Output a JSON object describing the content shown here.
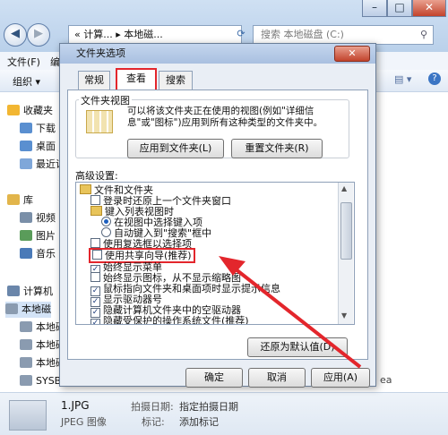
{
  "explorer": {
    "address": "« 计算... ▸ 本地磁...",
    "search_placeholder": "搜索 本地磁盘 (C:)",
    "menu": [
      "文件(F)",
      "编辑"
    ],
    "organize": "组织 ▾",
    "nav": [
      {
        "label": "收藏夹",
        "icon": "star-icon",
        "color": "#f2b632"
      },
      {
        "label": "下载",
        "icon": "folder-icon",
        "color": "#5a8fd0"
      },
      {
        "label": "桌面",
        "icon": "folder-icon",
        "color": "#5a8fd0"
      },
      {
        "label": "最近访",
        "icon": "folder-icon",
        "color": "#7fa7d9"
      },
      {
        "label": "库",
        "icon": "library-icon",
        "color": "#e2b54b"
      },
      {
        "label": "视频",
        "icon": "video-icon",
        "color": "#7a8fa8"
      },
      {
        "label": "图片",
        "icon": "picture-icon",
        "color": "#5a9c5a"
      },
      {
        "label": "音乐",
        "icon": "music-icon",
        "color": "#4a7ab8"
      },
      {
        "label": "计算机",
        "icon": "computer-icon",
        "color": "#6a86aa"
      },
      {
        "label": "本地磁",
        "icon": "drive-icon",
        "color": "#8a9bb0"
      },
      {
        "label": "本地磁",
        "icon": "drive-icon",
        "color": "#8a9bb0"
      },
      {
        "label": "本地磁",
        "icon": "drive-icon",
        "color": "#8a9bb0"
      },
      {
        "label": "本地磁",
        "icon": "drive-icon",
        "color": "#8a9bb0"
      },
      {
        "label": "SYSBA",
        "icon": "drive-icon",
        "color": "#8a9bb0"
      }
    ],
    "right_fragment": "ea",
    "status": {
      "file": "1.JPG",
      "type": "JPEG 图像",
      "k1": "拍摄日期:",
      "v1": "指定拍摄日期",
      "k2": "标记:",
      "v2": "添加标记"
    }
  },
  "dialog": {
    "title": "文件夹选项",
    "close": "✕",
    "tabs": [
      "常规",
      "查看",
      "搜索"
    ],
    "folder_views": {
      "title": "文件夹视图",
      "description": "可以将该文件夹正在使用的视图(例如\"详细信息\"或\"图标\")应用到所有这种类型的文件夹中。",
      "apply_button": "应用到文件夹(L)",
      "reset_button": "重置文件夹(R)"
    },
    "advanced_label": "高级设置:",
    "tree": [
      {
        "kind": "folder",
        "label": "文件和文件夹",
        "indent": 0
      },
      {
        "kind": "checkbox",
        "checked": false,
        "label": "登录时还原上一个文件夹窗口",
        "indent": 1
      },
      {
        "kind": "folder",
        "label": "键入列表视图时",
        "indent": 1
      },
      {
        "kind": "radio",
        "checked": true,
        "label": "在视图中选择键入项",
        "indent": 2
      },
      {
        "kind": "radio",
        "checked": false,
        "label": "自动键入到\"搜索\"框中",
        "indent": 2
      },
      {
        "kind": "checkbox",
        "checked": false,
        "label": "使用复选框以选择项",
        "indent": 1
      },
      {
        "kind": "checkbox",
        "checked": false,
        "label": "使用共享向导(推荐)",
        "indent": 1
      },
      {
        "kind": "checkbox",
        "checked": true,
        "label": "始终显示菜单",
        "indent": 1
      },
      {
        "kind": "checkbox",
        "checked": false,
        "label": "始终显示图标，从不显示缩略图",
        "indent": 1
      },
      {
        "kind": "checkbox",
        "checked": true,
        "label": "鼠标指向文件夹和桌面项时显示提示信息",
        "indent": 1
      },
      {
        "kind": "checkbox",
        "checked": true,
        "label": "显示驱动器号",
        "indent": 1
      },
      {
        "kind": "checkbox",
        "checked": true,
        "label": "隐藏计算机文件夹中的空驱动器",
        "indent": 1
      },
      {
        "kind": "checkbox",
        "checked": true,
        "label": "隐藏受保护的操作系统文件(推荐)",
        "indent": 1
      }
    ],
    "restore_button": "还原为默认值(D)",
    "ok_button": "确定",
    "cancel_button": "取消",
    "apply_button": "应用(A)"
  },
  "colors": {
    "highlight": "#e3262c",
    "title_bar": "#b6cae6"
  }
}
